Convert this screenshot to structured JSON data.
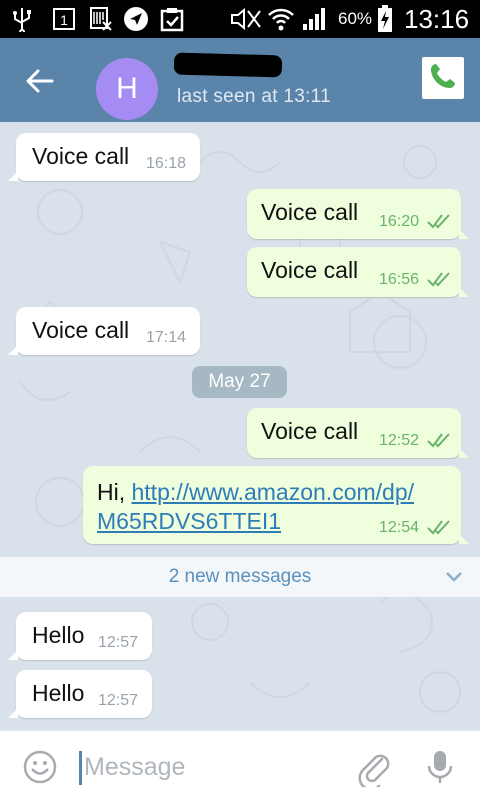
{
  "status_bar": {
    "sim_number": "1",
    "battery": "60%",
    "time": "13:16"
  },
  "header": {
    "avatar_letter": "H",
    "last_seen": "last seen at 13:11"
  },
  "messages": [
    {
      "direction": "in",
      "text": "Voice call",
      "time": "16:18"
    },
    {
      "direction": "out",
      "text": "Voice call",
      "time": "16:20"
    },
    {
      "direction": "out",
      "text": "Voice call",
      "time": "16:56"
    },
    {
      "direction": "in",
      "text": "Voice call",
      "time": "17:14"
    },
    {
      "direction": "out",
      "text": "Voice call",
      "time": "12:52"
    },
    {
      "direction": "out",
      "text_prefix": "Hi, ",
      "link_line1": "http://www.amazon.com/dp/",
      "link_line2": "M65RDVS6TTEI1",
      "time": "12:54"
    },
    {
      "direction": "in",
      "text": "Hello",
      "time": "12:57"
    },
    {
      "direction": "in",
      "text": "Hello",
      "time": "12:57"
    }
  ],
  "date_separator": "May 27",
  "new_messages": "2 new messages",
  "composer": {
    "placeholder": "Message"
  },
  "colors": {
    "header": "#5b84aa",
    "chat_bg": "#d9e2ea",
    "bubble_out": "#effedd",
    "avatar": "#a58cf2",
    "call_green": "#4caf50",
    "check_green": "#6bb36b"
  },
  "icons": [
    "usb-icon",
    "sim-icon",
    "barcode-icon",
    "location-icon",
    "clipboard-check-icon",
    "mute-icon",
    "wifi-icon",
    "signal-icon",
    "battery-charging-icon",
    "back-arrow-icon",
    "phone-icon",
    "double-check-icon",
    "chevron-down-icon",
    "emoji-icon",
    "attach-icon",
    "mic-icon"
  ]
}
